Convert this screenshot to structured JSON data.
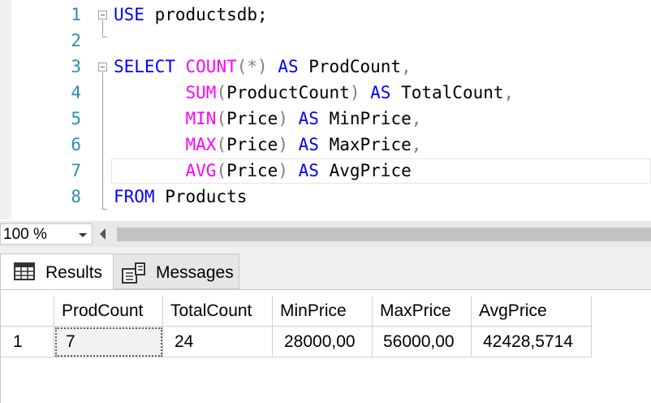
{
  "editor": {
    "line_numbers": [
      "1",
      "2",
      "3",
      "4",
      "5",
      "6",
      "7",
      "8"
    ],
    "lines": [
      [
        {
          "t": "USE",
          "c": "kw"
        },
        {
          "t": " productsdb;",
          "c": ""
        }
      ],
      [],
      [
        {
          "t": "SELECT",
          "c": "kw"
        },
        {
          "t": " ",
          "c": ""
        },
        {
          "t": "COUNT",
          "c": "fn"
        },
        {
          "t": "(*)",
          "c": "gr"
        },
        {
          "t": " ",
          "c": ""
        },
        {
          "t": "AS",
          "c": "kw"
        },
        {
          "t": " ProdCount",
          "c": ""
        },
        {
          "t": ",",
          "c": "gr"
        }
      ],
      [
        {
          "t": "       ",
          "c": ""
        },
        {
          "t": "SUM",
          "c": "fn"
        },
        {
          "t": "(",
          "c": "gr"
        },
        {
          "t": "ProductCount",
          "c": ""
        },
        {
          "t": ")",
          "c": "gr"
        },
        {
          "t": " ",
          "c": ""
        },
        {
          "t": "AS",
          "c": "kw"
        },
        {
          "t": " TotalCount",
          "c": ""
        },
        {
          "t": ",",
          "c": "gr"
        }
      ],
      [
        {
          "t": "       ",
          "c": ""
        },
        {
          "t": "MIN",
          "c": "fn"
        },
        {
          "t": "(",
          "c": "gr"
        },
        {
          "t": "Price",
          "c": ""
        },
        {
          "t": ")",
          "c": "gr"
        },
        {
          "t": " ",
          "c": ""
        },
        {
          "t": "AS",
          "c": "kw"
        },
        {
          "t": " MinPrice",
          "c": ""
        },
        {
          "t": ",",
          "c": "gr"
        }
      ],
      [
        {
          "t": "       ",
          "c": ""
        },
        {
          "t": "MAX",
          "c": "fn"
        },
        {
          "t": "(",
          "c": "gr"
        },
        {
          "t": "Price",
          "c": ""
        },
        {
          "t": ")",
          "c": "gr"
        },
        {
          "t": " ",
          "c": ""
        },
        {
          "t": "AS",
          "c": "kw"
        },
        {
          "t": " MaxPrice",
          "c": ""
        },
        {
          "t": ",",
          "c": "gr"
        }
      ],
      [
        {
          "t": "       ",
          "c": ""
        },
        {
          "t": "AVG",
          "c": "fn"
        },
        {
          "t": "(",
          "c": "gr"
        },
        {
          "t": "Price",
          "c": ""
        },
        {
          "t": ")",
          "c": "gr"
        },
        {
          "t": " ",
          "c": ""
        },
        {
          "t": "AS",
          "c": "kw"
        },
        {
          "t": " AvgPrice",
          "c": ""
        }
      ],
      [
        {
          "t": "FROM",
          "c": "kw"
        },
        {
          "t": " Products",
          "c": ""
        }
      ]
    ]
  },
  "zoom": {
    "value": "100 %"
  },
  "tabs": {
    "results": "Results",
    "messages": "Messages"
  },
  "grid": {
    "columns": [
      "ProdCount",
      "TotalCount",
      "MinPrice",
      "MaxPrice",
      "AvgPrice"
    ],
    "rows": [
      {
        "num": "1",
        "cells": [
          "7",
          "24",
          "28000,00",
          "56000,00",
          "42428,5714"
        ]
      }
    ]
  },
  "colors": {
    "keyword": "#0000ff",
    "function": "#ff00ff",
    "operator": "#808080",
    "line_number": "#2b91af"
  }
}
